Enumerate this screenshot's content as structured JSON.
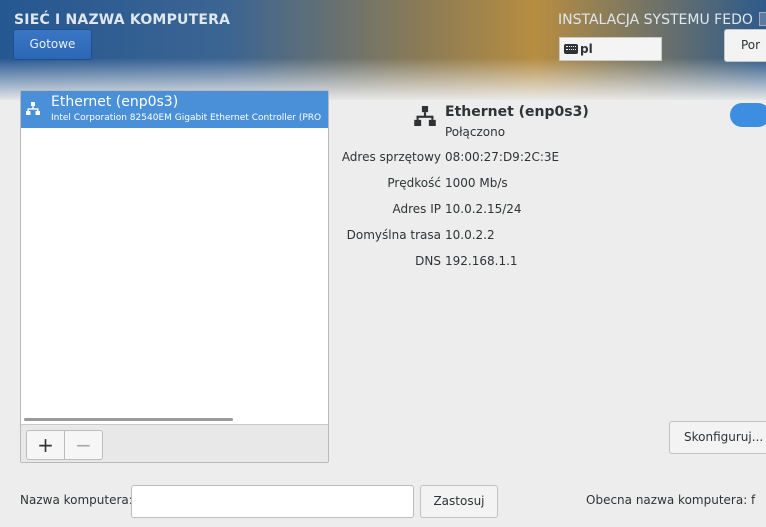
{
  "header": {
    "title": "SIEĆ I NAZWA KOMPUTERA",
    "done_label": "Gotowe",
    "install_title": "INSTALACJA SYSTEMU FEDO",
    "keyboard_layout": "pl",
    "help_label": "Por"
  },
  "device_list": {
    "items": [
      {
        "name": "Ethernet (enp0s3)",
        "description": "Intel Corporation 82540EM Gigabit Ethernet Controller (PRO"
      }
    ],
    "add_label": "+",
    "remove_label": "−"
  },
  "details": {
    "name": "Ethernet (enp0s3)",
    "status": "Połączono",
    "toggle_on": true,
    "rows": [
      {
        "label": "Adres sprzętowy",
        "value": "08:00:27:D9:2C:3E"
      },
      {
        "label": "Prędkość",
        "value": "1000 Mb/s"
      },
      {
        "label": "Adres IP",
        "value": "10.0.2.15/24"
      },
      {
        "label": "Domyślna trasa",
        "value": "10.0.2.2"
      },
      {
        "label": "DNS",
        "value": "192.168.1.1"
      }
    ],
    "configure_label": "Skonfiguruj..."
  },
  "hostname": {
    "label": "Nazwa komputera:",
    "value": "",
    "apply_label": "Zastosuj",
    "current_label": "Obecna nazwa komputera:",
    "current_value": "f"
  },
  "colors": {
    "accent": "#4a90d9",
    "toggle": "#3d8de0"
  }
}
